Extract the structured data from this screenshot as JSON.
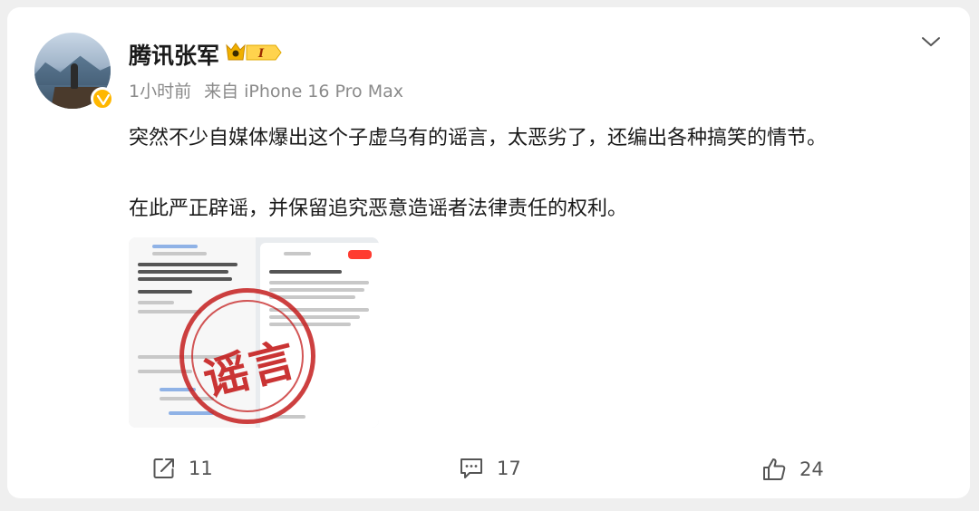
{
  "post": {
    "author": "腾讯张军",
    "level_badge": "I",
    "time": "1小时前",
    "source": "来自 iPhone 16 Pro Max",
    "lines": [
      "突然不少自媒体爆出这个子虚乌有的谣言，太恶劣了，还编出各种搞笑的情节。",
      "在此严正辟谣，并保留追究恶意造谣者法律责任的权利。"
    ],
    "stamp_text": "谣言"
  },
  "actions": {
    "repost_count": "11",
    "comment_count": "17",
    "like_count": "24"
  },
  "colors": {
    "verified": "#ffb700",
    "stamp": "#c41e1e",
    "text": "#1a1a1a",
    "meta": "#8a8a8a"
  },
  "icons": [
    "chevron-down-icon",
    "share-icon",
    "comment-icon",
    "like-icon",
    "verified-icon",
    "level-badge-icon"
  ]
}
